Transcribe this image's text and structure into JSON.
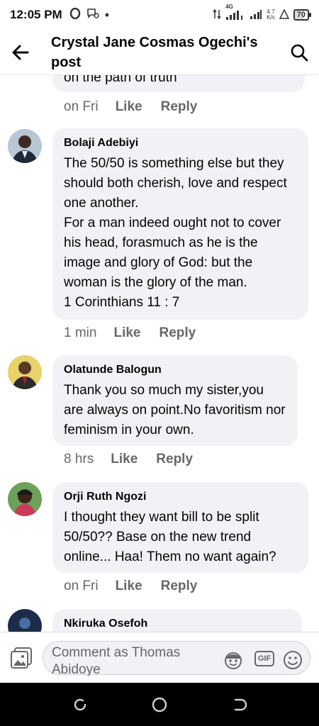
{
  "status_bar": {
    "time": "12:05 PM",
    "network_type": "4G",
    "net_speed_value": "4.7",
    "net_speed_unit": "K/s",
    "battery": "70"
  },
  "header": {
    "title": "Crystal Jane Cosmas Ogechi's post"
  },
  "previous_comment": {
    "text_tail": "on the path of truth",
    "time": "on Fri",
    "like_label": "Like",
    "reply_label": "Reply"
  },
  "comments": [
    {
      "author": "Bolaji Adebiyi",
      "text": "The 50/50 is something else but they should both cherish, love and respect one another.\nFor a man indeed ought not to cover his head, forasmuch as he is the image and glory of God: but the woman is the glory of the man.\n1 Corinthians 11 : 7",
      "time": "1 min",
      "like_label": "Like",
      "reply_label": "Reply"
    },
    {
      "author": "Olatunde Balogun",
      "text": "Thank you so much my sister,you are always on point.No favoritism nor feminism in your own.",
      "time": "8 hrs",
      "like_label": "Like",
      "reply_label": "Reply"
    },
    {
      "author": "Orji Ruth Ngozi",
      "text": "I thought they want bill to be split 50/50?? Base on the new trend online... Haa! Them no want again?",
      "time": "on Fri",
      "like_label": "Like",
      "reply_label": "Reply"
    },
    {
      "author": "Nkiruka Osefoh"
    }
  ],
  "composer": {
    "placeholder": "Comment as Thomas Abidoye",
    "gif_label": "GIF"
  },
  "colors": {
    "bubble_bg": "#f0f2f5",
    "secondary_text": "#65676b",
    "primary_text": "#050505"
  }
}
